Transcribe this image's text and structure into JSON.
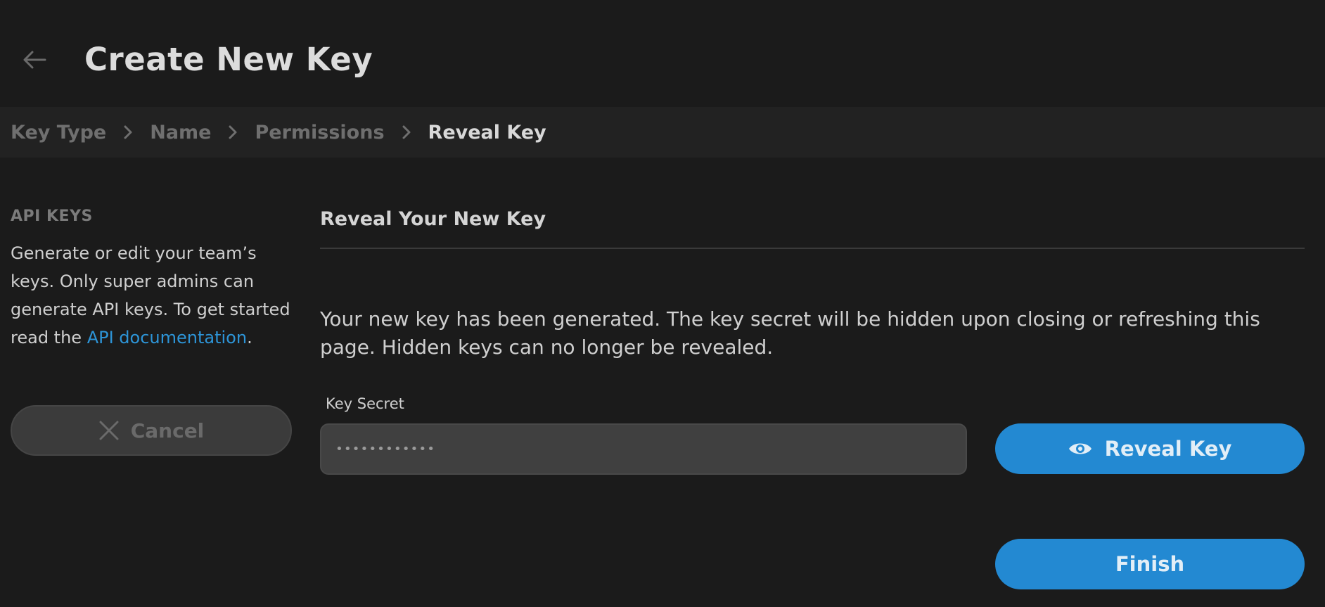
{
  "header": {
    "title": "Create New Key",
    "back_icon": "arrow-left-icon"
  },
  "breadcrumb": {
    "items": [
      {
        "label": "Key Type",
        "active": false
      },
      {
        "label": "Name",
        "active": false
      },
      {
        "label": "Permissions",
        "active": false
      },
      {
        "label": "Reveal Key",
        "active": true
      }
    ],
    "separator_icon": "chevron-right-icon"
  },
  "sidebar": {
    "heading": "API KEYS",
    "description": "Generate or edit your team’s keys. Only super admins can generate API keys. To get started read the",
    "link_label": "API documentation",
    "link_suffix": ".",
    "cancel_label": "Cancel",
    "cancel_icon": "close-icon"
  },
  "main": {
    "section_title": "Reveal Your New Key",
    "notice": "Your new key has been generated. The key secret will be hidden upon closing or refreshing this page. Hidden keys can no longer be revealed.",
    "key_secret": {
      "label": "Key Secret",
      "value": "••••••••••••"
    },
    "reveal_label": "Reveal Key",
    "reveal_icon": "eye-icon",
    "finish_label": "Finish"
  },
  "colors": {
    "background": "#1b1b1b",
    "breadcrumb_bar": "#222222",
    "primary": "#2389d2",
    "link": "#2d95d8"
  }
}
